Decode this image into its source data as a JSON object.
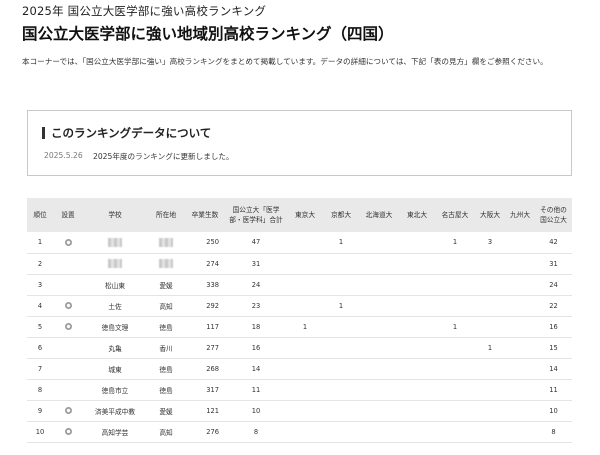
{
  "page": {
    "supertitle": "2025年 国公立大医学部に強い高校ランキング",
    "title": "国公立大医学部に強い地域別高校ランキング（四国）",
    "intro": "本コーナーでは、「国公立大医学部に強い」高校ランキングをまとめて掲載しています。データの詳細については、下記「表の見方」欄をご参照ください。"
  },
  "notice": {
    "heading": "このランキングデータについて",
    "date": "2025.5.26",
    "text": "2025年度のランキングに更新しました。"
  },
  "table": {
    "headers": {
      "rank": "順位",
      "setup": "設置",
      "school": "学校",
      "location": "所在地",
      "graduates": "卒業生数",
      "national_total": "国公立大「医学部・医学科」合計",
      "tokyo": "東京大",
      "kyoto": "京都大",
      "hokkaido": "北海道大",
      "tohoku": "東北大",
      "nagoya": "名古屋大",
      "osaka": "大阪大",
      "kyushu": "九州大",
      "other": "その他の国公立大"
    },
    "rows": [
      {
        "rank": "1",
        "setup_icon": "medal-icon",
        "school": "",
        "school_hidden": true,
        "location": "",
        "location_hidden": true,
        "graduates": "250",
        "total": "47",
        "tokyo": "",
        "kyoto": "1",
        "hokkaido": "",
        "tohoku": "",
        "nagoya": "1",
        "osaka": "3",
        "kyushu": "",
        "other": "42"
      },
      {
        "rank": "2",
        "setup_icon": "",
        "school": "",
        "school_hidden": true,
        "location": "",
        "location_hidden": true,
        "graduates": "274",
        "total": "31",
        "tokyo": "",
        "kyoto": "",
        "hokkaido": "",
        "tohoku": "",
        "nagoya": "",
        "osaka": "",
        "kyushu": "",
        "other": "31"
      },
      {
        "rank": "3",
        "setup_icon": "",
        "school": "松山東",
        "location": "愛媛",
        "graduates": "338",
        "total": "24",
        "tokyo": "",
        "kyoto": "",
        "hokkaido": "",
        "tohoku": "",
        "nagoya": "",
        "osaka": "",
        "kyushu": "",
        "other": "24"
      },
      {
        "rank": "4",
        "setup_icon": "medal-icon",
        "school": "土佐",
        "location": "高知",
        "graduates": "292",
        "total": "23",
        "tokyo": "",
        "kyoto": "1",
        "hokkaido": "",
        "tohoku": "",
        "nagoya": "",
        "osaka": "",
        "kyushu": "",
        "other": "22"
      },
      {
        "rank": "5",
        "setup_icon": "medal-icon",
        "school": "徳島文理",
        "location": "徳島",
        "graduates": "117",
        "total": "18",
        "tokyo": "1",
        "kyoto": "",
        "hokkaido": "",
        "tohoku": "",
        "nagoya": "1",
        "osaka": "",
        "kyushu": "",
        "other": "16"
      },
      {
        "rank": "6",
        "setup_icon": "",
        "school": "丸亀",
        "location": "香川",
        "graduates": "277",
        "total": "16",
        "tokyo": "",
        "kyoto": "",
        "hokkaido": "",
        "tohoku": "",
        "nagoya": "",
        "osaka": "1",
        "kyushu": "",
        "other": "15"
      },
      {
        "rank": "7",
        "setup_icon": "",
        "school": "城東",
        "location": "徳島",
        "graduates": "268",
        "total": "14",
        "tokyo": "",
        "kyoto": "",
        "hokkaido": "",
        "tohoku": "",
        "nagoya": "",
        "osaka": "",
        "kyushu": "",
        "other": "14"
      },
      {
        "rank": "8",
        "setup_icon": "",
        "school": "徳島市立",
        "location": "徳島",
        "graduates": "317",
        "total": "11",
        "tokyo": "",
        "kyoto": "",
        "hokkaido": "",
        "tohoku": "",
        "nagoya": "",
        "osaka": "",
        "kyushu": "",
        "other": "11"
      },
      {
        "rank": "9",
        "setup_icon": "medal-icon",
        "school": "済美平成中教",
        "location": "愛媛",
        "graduates": "121",
        "total": "10",
        "tokyo": "",
        "kyoto": "",
        "hokkaido": "",
        "tohoku": "",
        "nagoya": "",
        "osaka": "",
        "kyushu": "",
        "other": "10"
      },
      {
        "rank": "10",
        "setup_icon": "medal-icon",
        "school": "高知学芸",
        "location": "高知",
        "graduates": "276",
        "total": "8",
        "tokyo": "",
        "kyoto": "",
        "hokkaido": "",
        "tohoku": "",
        "nagoya": "",
        "osaka": "",
        "kyushu": "",
        "other": "8"
      }
    ]
  }
}
